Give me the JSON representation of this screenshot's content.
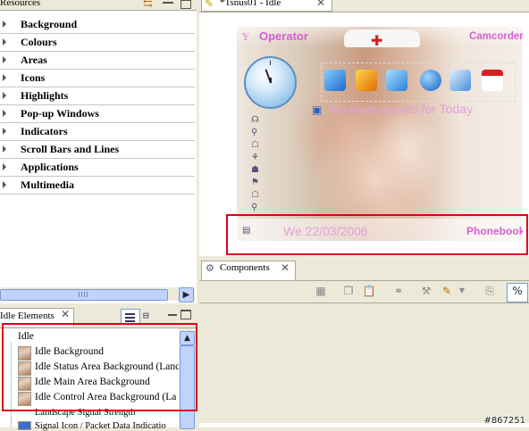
{
  "resources_panel": {
    "title": "Resources",
    "items": [
      {
        "label": "Background"
      },
      {
        "label": "Colours"
      },
      {
        "label": "Areas"
      },
      {
        "label": "Icons"
      },
      {
        "label": "Highlights"
      },
      {
        "label": "Pop-up Windows"
      },
      {
        "label": "Indicators"
      },
      {
        "label": "Scroll Bars and Lines"
      },
      {
        "label": "Applications"
      },
      {
        "label": "Multimedia"
      }
    ]
  },
  "idle_elements_panel": {
    "title": "Idle Elements",
    "root": "Idle",
    "items": [
      {
        "label": "Idle Background"
      },
      {
        "label": "Idle Status Area Background (Lanc"
      },
      {
        "label": "Idle Main Area Background"
      },
      {
        "label": "Idle Control Area Background (La"
      },
      {
        "label": "Landscape Signal Strength"
      },
      {
        "label": "Signal Icon / Packet Data Indicatio"
      }
    ]
  },
  "editor": {
    "tab_label": "*Tsnus01 - Idle",
    "phone": {
      "operator": "Operator",
      "camcorder": "Camcorder",
      "events_text": "No more events for Today",
      "date": "We 22/03/2006",
      "phonebook": "Phonebook"
    }
  },
  "components_view": {
    "tab_label": "Components"
  },
  "watermark": "#867251",
  "colors": {
    "accent_red": "#e0001a",
    "phone_label_pink": "#d65ed6",
    "selection_blue": "#7a99d8"
  }
}
